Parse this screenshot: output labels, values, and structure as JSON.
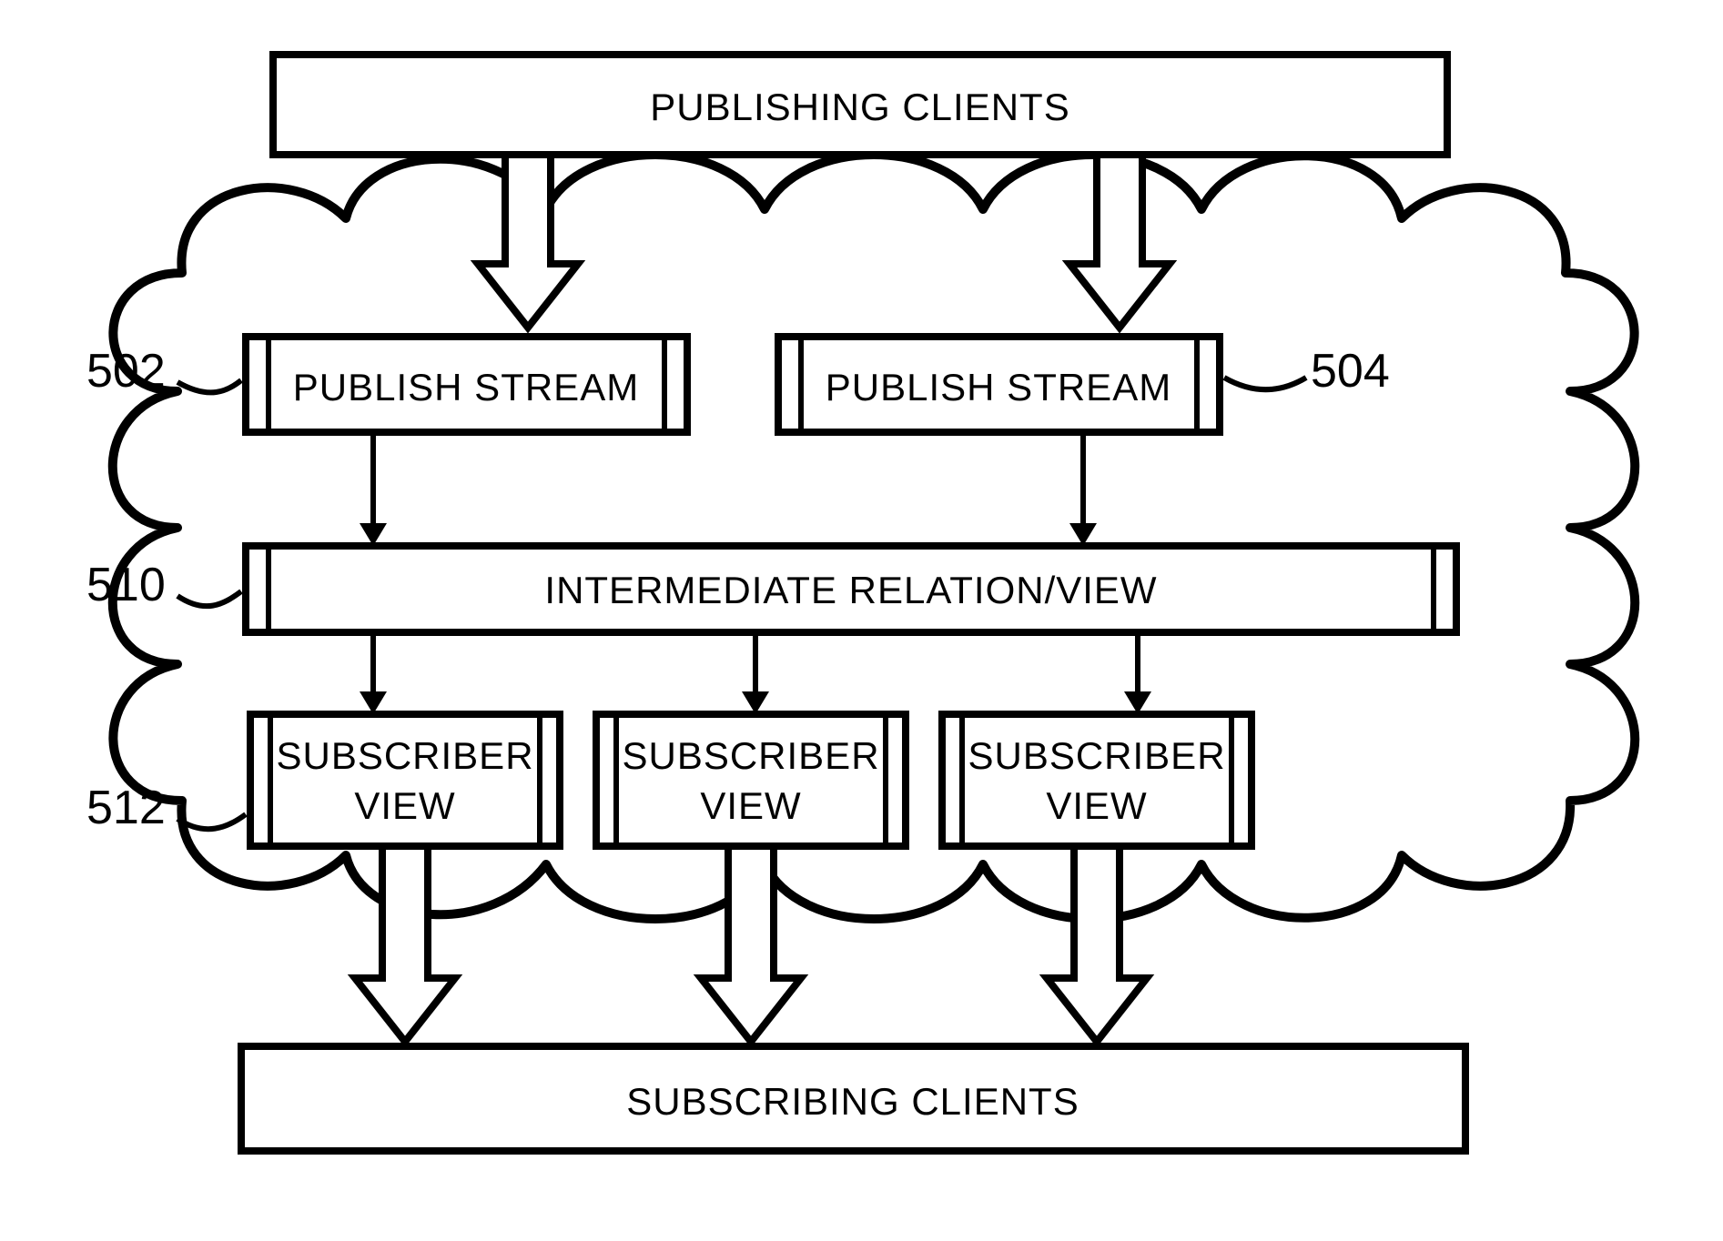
{
  "boxes": {
    "publishing_clients": {
      "label": "PUBLISHING CLIENTS"
    },
    "publish_stream_left": {
      "label": "PUBLISH STREAM",
      "ref": "502"
    },
    "publish_stream_right": {
      "label": "PUBLISH STREAM",
      "ref": "504"
    },
    "intermediate": {
      "label": "INTERMEDIATE RELATION/VIEW",
      "ref": "510"
    },
    "subscriber_view_1": {
      "line1": "SUBSCRIBER",
      "line2": "VIEW",
      "ref": "512"
    },
    "subscriber_view_2": {
      "line1": "SUBSCRIBER",
      "line2": "VIEW"
    },
    "subscriber_view_3": {
      "line1": "SUBSCRIBER",
      "line2": "VIEW"
    },
    "subscribing_clients": {
      "label": "SUBSCRIBING CLIENTS"
    }
  }
}
